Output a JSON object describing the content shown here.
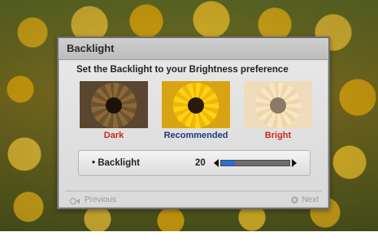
{
  "dialog": {
    "title": "Backlight",
    "subtitle": "Set the Backlight to your Brightness preference"
  },
  "presets": [
    {
      "label": "Dark",
      "color": "#c92a1a"
    },
    {
      "label": "Recommended",
      "color": "#1f3a7a"
    },
    {
      "label": "Bright",
      "color": "#c92a1a"
    }
  ],
  "setting": {
    "label": "• Backlight",
    "value": "20",
    "level_fraction": 0.2,
    "fill_color": "#2b6fd6"
  },
  "footer": {
    "previous_label": "Previous",
    "previous_icon": "return-icon",
    "next_label": "Next",
    "next_icon": "dot-button-icon"
  }
}
